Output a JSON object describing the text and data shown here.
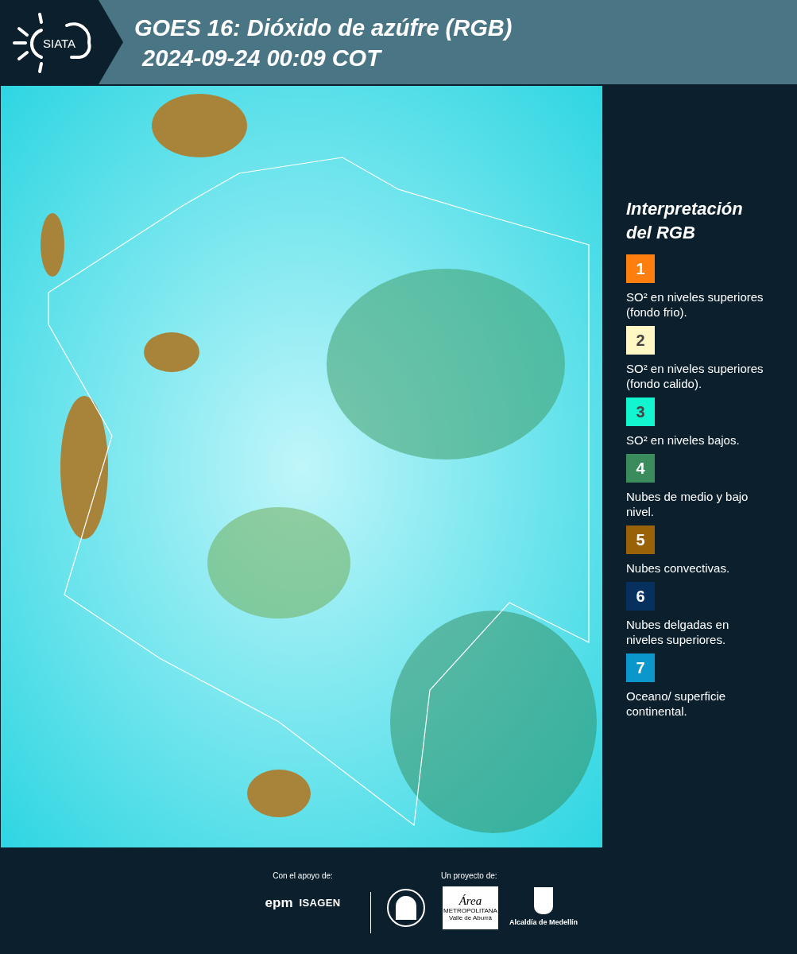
{
  "header": {
    "logo_text": "SIATA",
    "title": "GOES 16: Dióxido de azúfre (RGB)",
    "subtitle": "2024-09-24 00:09 COT"
  },
  "legend": {
    "title": "Interpretación del RGB",
    "items": [
      {
        "number": "1",
        "color": "#ff7f0e",
        "label": "SO² en niveles superiores (fondo frio)."
      },
      {
        "number": "2",
        "color": "#fff8c4",
        "label": "SO² en niveles superiores (fondo calido)."
      },
      {
        "number": "3",
        "color": "#12f5cf",
        "label": "SO² en niveles bajos."
      },
      {
        "number": "4",
        "color": "#3a8c5c",
        "label": "Nubes de medio y bajo nivel."
      },
      {
        "number": "5",
        "color": "#9a6208",
        "label": "Nubes convectivas."
      },
      {
        "number": "6",
        "color": "#06305e",
        "label": "Nubes delgadas en niveles superiores."
      },
      {
        "number": "7",
        "color": "#0c97cc",
        "label": "Oceano/ superficie continental."
      }
    ]
  },
  "footer": {
    "support_label": "Con el apoyo de:",
    "support_logos": [
      "epm",
      "ISAGEN"
    ],
    "project_label": "Un proyecto de:",
    "area_logo": {
      "title": "Área",
      "subtitle": "METROPOLITANA Valle de Aburrá"
    },
    "alcaldia_text": "Alcaldía de Medellín"
  }
}
